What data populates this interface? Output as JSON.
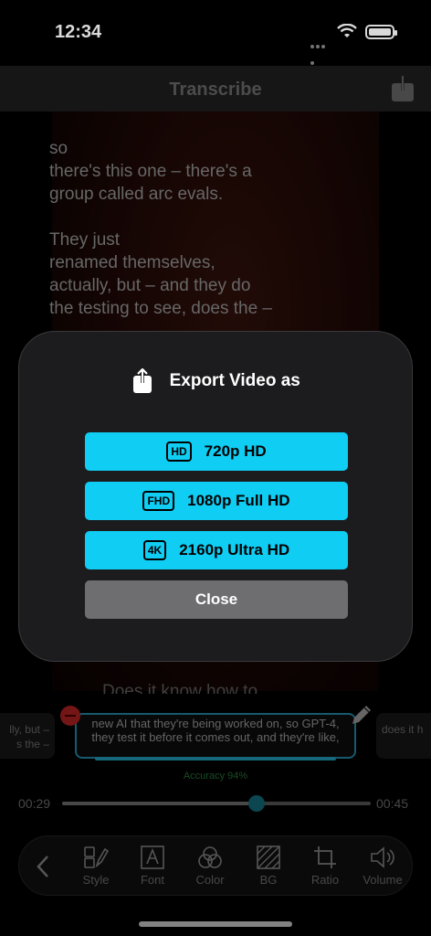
{
  "status": {
    "time": "12:34"
  },
  "nav": {
    "title": "Transcribe"
  },
  "video": {
    "para1": "so\nthere's this one – there's a\ngroup called arc evals.",
    "para2": "They just\nrenamed themselves,\nactually, but – and they do\nthe testing to see, does the –",
    "para3": "Does it know how to"
  },
  "captions": {
    "left": "lly, but –\ns the –",
    "current": "new AI that they're being worked on, so GPT-4, they test it before it comes out, and they're like,",
    "right": "does it h",
    "accuracy": "Accuracy 94%"
  },
  "timeline": {
    "current": "00:29",
    "end": "00:45",
    "progress": 0.63
  },
  "toolbar": {
    "items": [
      {
        "label": "Style",
        "icon": "style-icon"
      },
      {
        "label": "Font",
        "icon": "font-icon"
      },
      {
        "label": "Color",
        "icon": "color-icon"
      },
      {
        "label": "BG",
        "icon": "background-icon"
      },
      {
        "label": "Ratio",
        "icon": "crop-icon"
      },
      {
        "label": "Volume",
        "icon": "volume-icon"
      }
    ]
  },
  "modal": {
    "title": "Export Video as",
    "options": [
      {
        "badge": "HD",
        "label": "720p HD"
      },
      {
        "badge": "FHD",
        "label": "1080p Full HD"
      },
      {
        "badge": "4K",
        "label": "2160p Ultra HD"
      }
    ],
    "close": "Close"
  },
  "colors": {
    "accent": "#10cdf3",
    "modal_bg": "#1c1c1e",
    "close_bg": "#6e6e70"
  }
}
